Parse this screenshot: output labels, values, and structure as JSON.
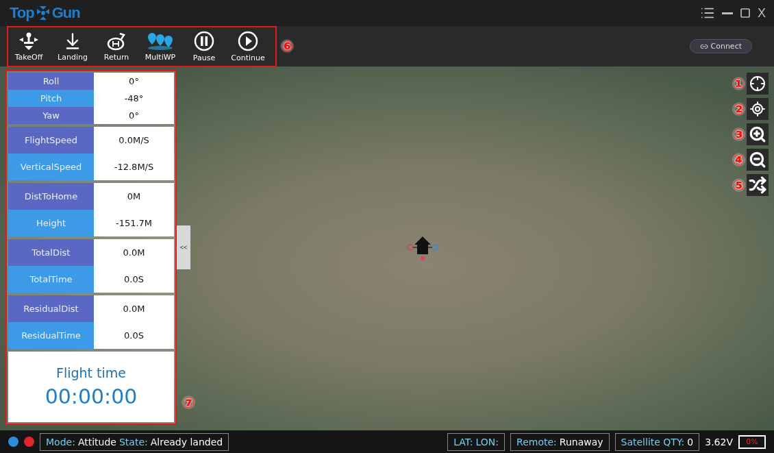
{
  "window": {
    "logo": [
      "Top",
      "Gun"
    ],
    "controls": [
      {
        "kind": "menu"
      },
      {
        "kind": "minimize"
      },
      {
        "kind": "maximize"
      },
      {
        "kind": "close",
        "label": "X"
      }
    ]
  },
  "toolbar": {
    "callout": "⑥",
    "buttons": [
      {
        "label": "TakeOff",
        "kind": "takeoff",
        "selected": false
      },
      {
        "label": "Landing",
        "kind": "landing",
        "selected": false
      },
      {
        "label": "Return",
        "kind": "return",
        "selected": false
      },
      {
        "label": "MultiWP",
        "kind": "multiwp",
        "selected": true
      },
      {
        "label": "Pause",
        "kind": "pause",
        "selected": false
      },
      {
        "label": "Continue",
        "kind": "continue",
        "selected": false
      }
    ],
    "connect": "Connect"
  },
  "panel": {
    "callout": "⑦",
    "collapse": "<<",
    "groups": [
      [
        {
          "label": "Roll",
          "value": "0°"
        },
        {
          "label": "Pitch",
          "value": "-48°"
        },
        {
          "label": "Yaw",
          "value": "0°"
        }
      ],
      [
        {
          "label": "FlightSpeed",
          "value": "0.0M/S"
        },
        {
          "label": "VerticalSpeed",
          "value": "-12.8M/S"
        }
      ],
      [
        {
          "label": "DistToHome",
          "value": "0M"
        },
        {
          "label": "Height",
          "value": "-151.7M"
        }
      ],
      [
        {
          "label": "TotalDist",
          "value": "0.0M"
        },
        {
          "label": "TotalTime",
          "value": "0.0S"
        }
      ],
      [
        {
          "label": "ResidualDist",
          "value": "0.0M"
        },
        {
          "label": "ResidualTime",
          "value": "0.0S"
        }
      ]
    ],
    "flight_time": {
      "label": "Flight time",
      "value": "00:00:00"
    }
  },
  "map_tools": [
    {
      "callout": "①",
      "kind": "crosshair"
    },
    {
      "callout": "②",
      "kind": "locate"
    },
    {
      "callout": "③",
      "kind": "zoom-in"
    },
    {
      "callout": "④",
      "kind": "zoom-out"
    },
    {
      "callout": "⑤",
      "kind": "shuffle"
    }
  ],
  "status_bar": {
    "lights": [
      {
        "color": "#2a8ee0"
      },
      {
        "color": "#e0262a"
      }
    ],
    "mode": {
      "label": "Mode:",
      "value": "Attitude"
    },
    "state": {
      "label": "State:",
      "value": "Already landed"
    },
    "lat": "LAT:",
    "lon": "LON:",
    "remote": {
      "label": "Remote:",
      "value": "Runaway"
    },
    "satellite": {
      "label": "Satellite QTY:",
      "value": "0"
    },
    "voltage": "3.62V",
    "battery": {
      "label": "0%"
    }
  }
}
